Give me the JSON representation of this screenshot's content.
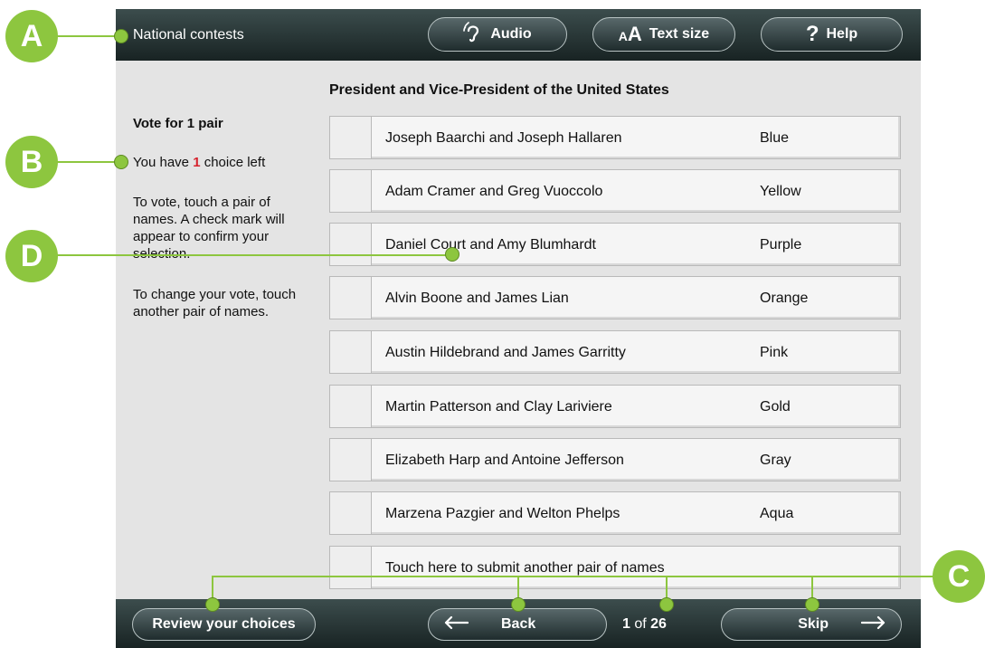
{
  "header": {
    "contest_label": "National contests",
    "audio_label": "Audio",
    "text_size_label": "Text size",
    "text_size_glyph": "AA",
    "help_label": "Help",
    "help_glyph": "?"
  },
  "main": {
    "contest_title": "President and Vice-President of the United States",
    "vote_for": "Vote for 1 pair",
    "choices_prefix": "You have ",
    "choices_count": "1",
    "choices_suffix": " choice left",
    "instruction_vote": "To vote, touch a pair of names. A check mark will appear to confirm your selection.",
    "instruction_change": "To change your vote, touch another pair of names.",
    "candidates": [
      {
        "name": "Joseph Baarchi and Joseph Hallaren",
        "party": "Blue"
      },
      {
        "name": "Adam Cramer and Greg Vuoccolo",
        "party": "Yellow"
      },
      {
        "name": "Daniel Court and Amy Blumhardt",
        "party": "Purple"
      },
      {
        "name": "Alvin Boone and James Lian",
        "party": "Orange"
      },
      {
        "name": "Austin Hildebrand and James Garritty",
        "party": "Pink"
      },
      {
        "name": "Martin Patterson and Clay Lariviere",
        "party": "Gold"
      },
      {
        "name": "Elizabeth Harp and Antoine Jefferson",
        "party": "Gray"
      },
      {
        "name": "Marzena Pazgier and Welton Phelps",
        "party": "Aqua"
      }
    ],
    "write_in_label": "Touch here to submit another pair of names"
  },
  "footer": {
    "review_label": "Review your choices",
    "back_label": "Back",
    "page_current": "1",
    "page_of": " of ",
    "page_total": "26",
    "skip_label": "Skip"
  },
  "callouts": {
    "a": "A",
    "b": "B",
    "c": "C",
    "d": "D"
  },
  "colors": {
    "accent_green": "#8dc63f",
    "bar_dark": "#1f2c2d",
    "highlight_red": "#d6232e"
  },
  "icons": {
    "audio": "ear-icon",
    "back": "arrow-left-icon",
    "skip": "arrow-right-icon",
    "help": "question-icon"
  }
}
